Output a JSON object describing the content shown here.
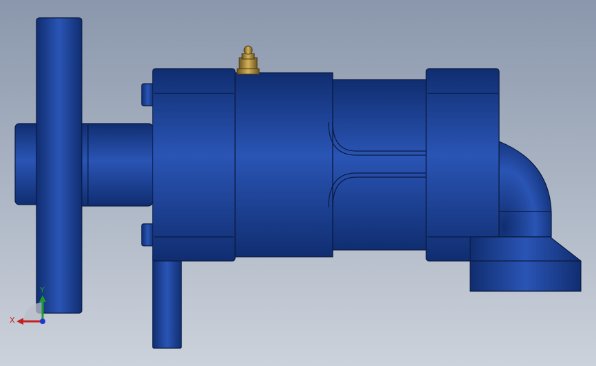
{
  "viewport": {
    "background_top": "#8a97ac",
    "background_bottom": "#ccd2db"
  },
  "model": {
    "body_color": "#1a3f92",
    "body_dark": "#102d70",
    "body_light": "#2a55b5",
    "edge_color": "#0a1a40",
    "fitting_color": "#a8873a"
  },
  "triad": {
    "x_label": "X",
    "y_label": "Y",
    "x_color": "#c42020",
    "y_color": "#1e9c2a",
    "z_color": "#1d36d0"
  }
}
